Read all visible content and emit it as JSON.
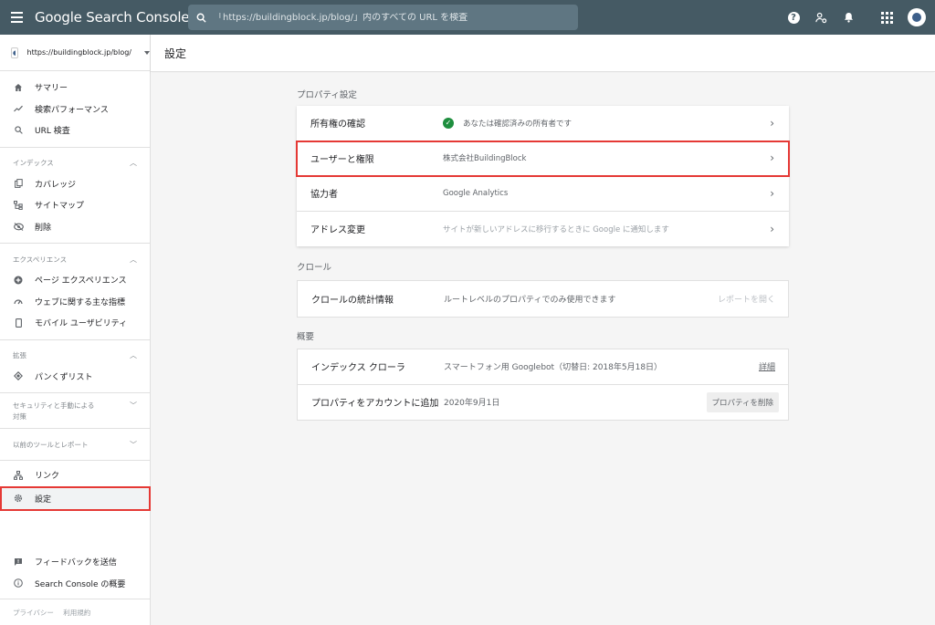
{
  "header": {
    "app_title": "Google Search Console",
    "search_placeholder": "「https://buildingblock.jp/blog/」内のすべての URL を検査"
  },
  "sidebar": {
    "property_url": "https://buildingblock.jp/blog/",
    "top_items": [
      {
        "icon": "home-icon",
        "label": "サマリー"
      },
      {
        "icon": "trending-up-icon",
        "label": "検索パフォーマンス"
      },
      {
        "icon": "search-icon",
        "label": "URL 検査"
      }
    ],
    "groups": [
      {
        "title": "インデックス",
        "expanded": true,
        "items": [
          {
            "icon": "coverage-icon",
            "label": "カバレッジ"
          },
          {
            "icon": "sitemap-icon",
            "label": "サイトマップ"
          },
          {
            "icon": "removals-icon",
            "label": "削除"
          }
        ]
      },
      {
        "title": "エクスペリエンス",
        "expanded": true,
        "items": [
          {
            "icon": "page-experience-icon",
            "label": "ページ エクスペリエンス"
          },
          {
            "icon": "speedometer-icon",
            "label": "ウェブに関する主な指標"
          },
          {
            "icon": "mobile-icon",
            "label": "モバイル ユーザビリティ"
          }
        ]
      },
      {
        "title": "拡張",
        "expanded": true,
        "items": [
          {
            "icon": "breadcrumbs-icon",
            "label": "パンくずリスト"
          }
        ]
      },
      {
        "title": "セキュリティと手動による対策",
        "expanded": false,
        "items": []
      },
      {
        "title": "以前のツールとレポート",
        "expanded": false,
        "items": []
      }
    ],
    "bottom_items": [
      {
        "icon": "links-icon",
        "label": "リンク"
      },
      {
        "icon": "gear-icon",
        "label": "設定"
      }
    ],
    "footer_items": [
      {
        "icon": "feedback-icon",
        "label": "フィードバックを送信"
      },
      {
        "icon": "info-icon",
        "label": "Search Console の概要"
      }
    ],
    "privacy": "プライバシー",
    "terms": "利用規約"
  },
  "page": {
    "title": "設定"
  },
  "property_settings": {
    "section_title": "プロパティ設定",
    "rows": [
      {
        "label": "所有権の確認",
        "value": "あなたは確認済みの所有者です"
      },
      {
        "label": "ユーザーと権限",
        "value": "株式会社BuildingBlock"
      },
      {
        "label": "協力者",
        "value": "Google Analytics"
      },
      {
        "label": "アドレス変更",
        "value": "サイトが新しいアドレスに移行するときに Google に通知します"
      }
    ]
  },
  "crawl": {
    "section_title": "クロール",
    "label": "クロールの統計情報",
    "value": "ルートレベルのプロパティでのみ使用できます",
    "action": "レポートを開く"
  },
  "overview": {
    "section_title": "概要",
    "crawler_label": "インデックス クローラ",
    "crawler_value": "スマートフォン用 Googlebot（切替日: 2018年5月18日）",
    "crawler_action": "詳細",
    "added_label": "プロパティをアカウントに追加",
    "added_value": "2020年9月1日",
    "remove_button": "プロパティを削除"
  },
  "colors": {
    "topbar": "#455a64",
    "highlight": "#e53935",
    "verified": "#1e8e3e"
  }
}
